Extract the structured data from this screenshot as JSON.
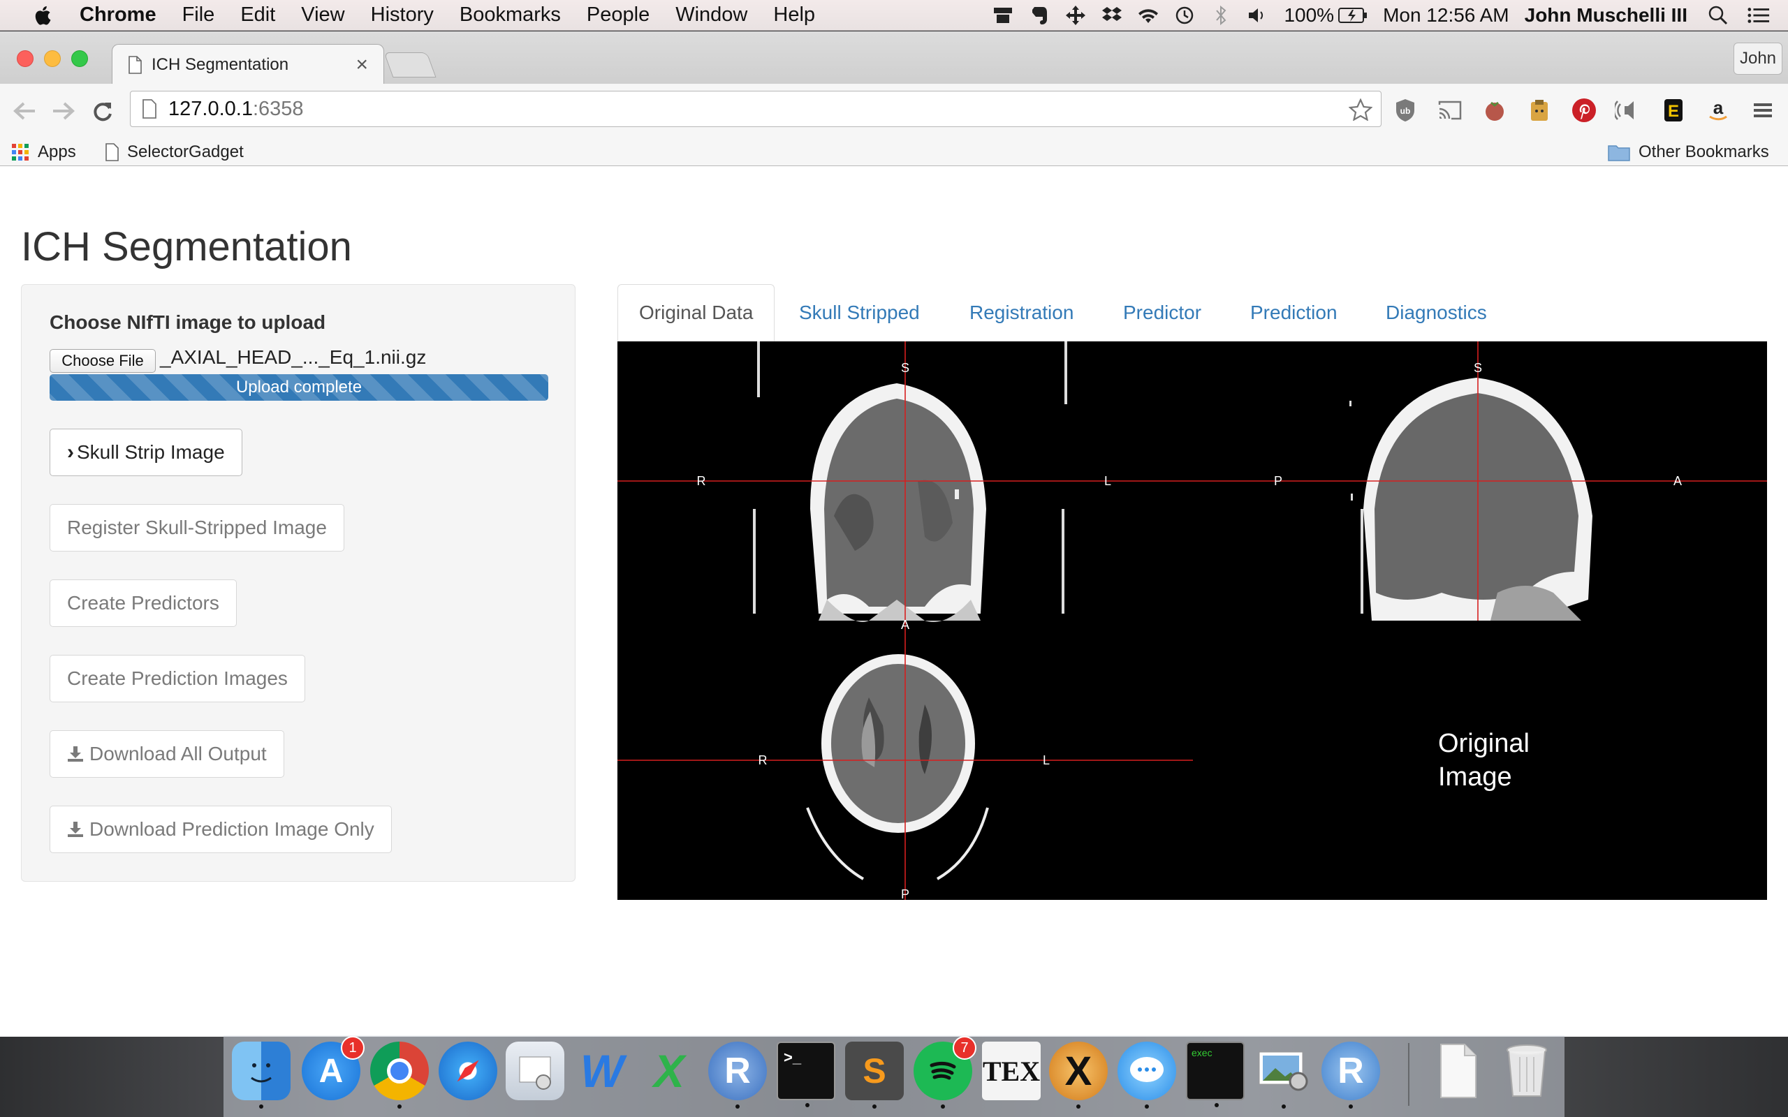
{
  "menubar": {
    "app_name": "Chrome",
    "items": [
      "File",
      "Edit",
      "View",
      "History",
      "Bookmarks",
      "People",
      "Window",
      "Help"
    ],
    "battery": "100%",
    "clock": "Mon 12:56 AM",
    "user": "John Muschelli III"
  },
  "browser": {
    "tab_title": "ICH Segmentation",
    "profile": "John",
    "url_host": "127.0.0.1",
    "url_port": ":6358",
    "bookmarks": [
      "Apps",
      "SelectorGadget"
    ],
    "other_bookmarks": "Other Bookmarks"
  },
  "app": {
    "title": "ICH Segmentation",
    "file_input": {
      "label": "Choose NIfTI image to upload",
      "button": "Choose File",
      "file_name": "_AXIAL_HEAD_..._Eq_1.nii.gz",
      "progress_text": "Upload complete",
      "progress": 1.0
    },
    "buttons": {
      "skull_strip": "Skull Strip Image",
      "register": "Register Skull-Stripped Image",
      "predictors": "Create Predictors",
      "prediction_images": "Create Prediction Images",
      "download_all": "Download All Output",
      "download_prediction": "Download Prediction Image Only"
    },
    "tabs": [
      "Original Data",
      "Skull Stripped",
      "Registration",
      "Predictor",
      "Prediction",
      "Diagnostics"
    ],
    "active_tab": "Original Data",
    "viewer": {
      "coronal_labels": {
        "top": "S",
        "left": "R",
        "right": "L"
      },
      "sagittal_labels": {
        "top": "S",
        "left": "P",
        "right": "A"
      },
      "axial_labels": {
        "top": "A",
        "left": "R",
        "right": "L",
        "bottom": "P"
      },
      "overlay_text_line1": "Original",
      "overlay_text_line2": "Image"
    }
  },
  "dock": {
    "apps": [
      "finder-icon",
      "app-store-icon",
      "chrome-icon",
      "safari-icon",
      "preview-icon",
      "word-icon",
      "excel-icon",
      "r-icon",
      "terminal-icon",
      "sublime-icon",
      "spotify-icon",
      "tex-icon",
      "x11-icon",
      "messages-icon",
      "exec-icon",
      "photo-icon",
      "rstudio-icon",
      "document-icon",
      "trash-icon"
    ],
    "app_store_badge": "1",
    "spotify_badge": "7",
    "tex_label": "TEX",
    "terminal_label": ">_",
    "r_label": "R",
    "exec_label": "exec"
  }
}
